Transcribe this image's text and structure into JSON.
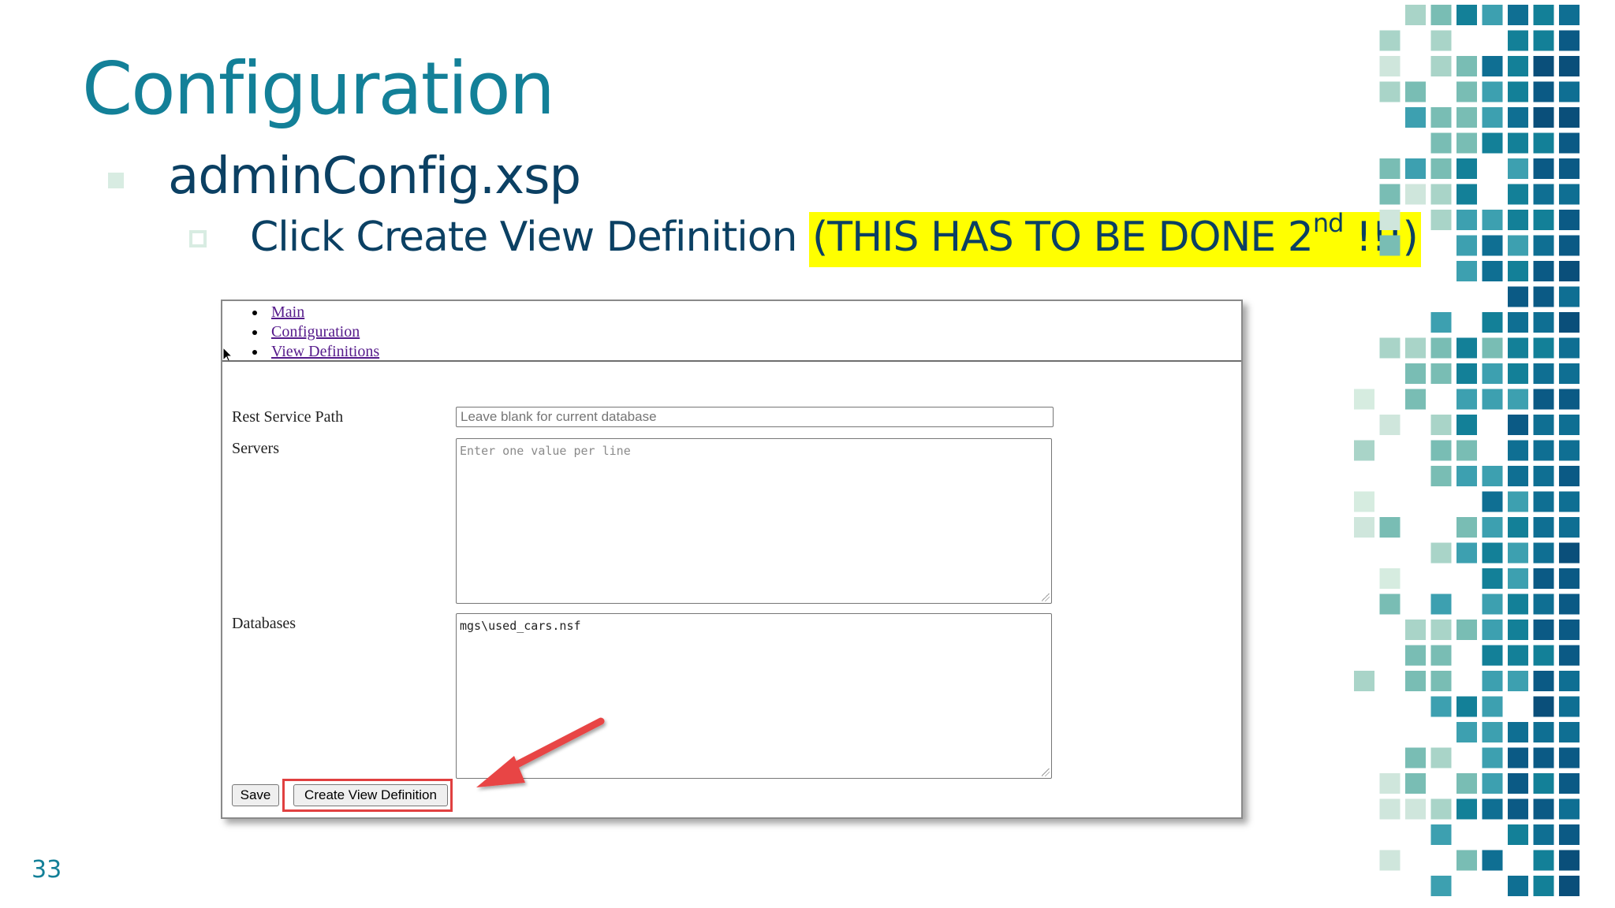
{
  "slide": {
    "title": "Configuration",
    "bullet1": "adminConfig.xsp",
    "bullet2_text": "Click Create View Definition",
    "bullet2_highlight": "(THIS HAS TO BE DONE 2",
    "bullet2_superscript": "nd",
    "bullet2_highlight_end": " !!!)",
    "page_number": "33",
    "colors": {
      "title": "#138098",
      "body": "#0b4063",
      "highlight": "#ffff00",
      "callout_red": "#e04040"
    }
  },
  "browser": {
    "nav": {
      "items": [
        "Main",
        "Configuration",
        "View Definitions"
      ]
    },
    "form": {
      "rest_service_path": {
        "label": "Rest Service Path",
        "placeholder": "Leave blank for current database",
        "value": ""
      },
      "servers": {
        "label": "Servers",
        "placeholder": "Enter one value per line",
        "value": ""
      },
      "databases": {
        "label": "Databases",
        "value": "mgs\\used_cars.nsf"
      }
    },
    "buttons": {
      "save": "Save",
      "create_view_definition": "Create View Definition"
    }
  },
  "icons": [
    "mouse-cursor-icon",
    "red-arrow-icon"
  ]
}
